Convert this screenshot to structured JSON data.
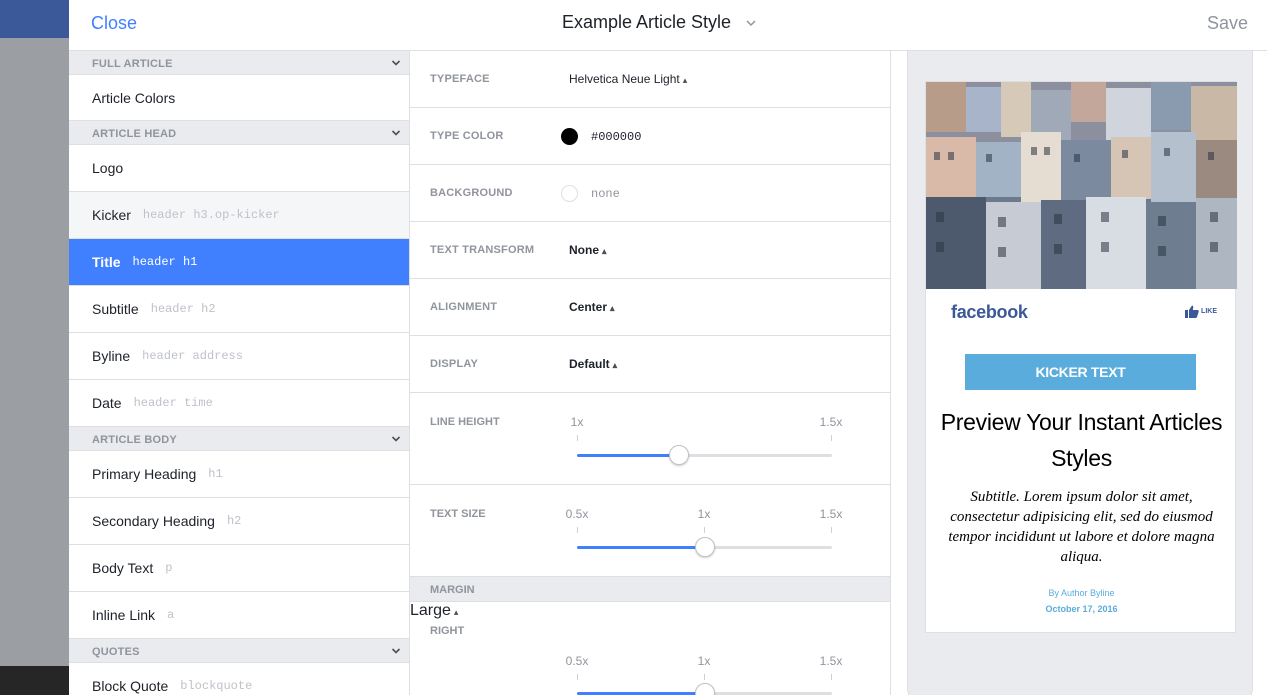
{
  "header": {
    "close_label": "Close",
    "title": "Example Article Style",
    "save_label": "Save"
  },
  "sidebar": {
    "sections": [
      {
        "label": "FULL ARTICLE",
        "items": [
          {
            "label": "Article Colors",
            "selector": ""
          }
        ]
      },
      {
        "label": "ARTICLE HEAD",
        "items": [
          {
            "label": "Logo",
            "selector": ""
          },
          {
            "label": "Kicker",
            "selector": "header h3.op-kicker"
          },
          {
            "label": "Title",
            "selector": "header h1"
          },
          {
            "label": "Subtitle",
            "selector": "header h2"
          },
          {
            "label": "Byline",
            "selector": "header address"
          },
          {
            "label": "Date",
            "selector": "header time"
          }
        ]
      },
      {
        "label": "ARTICLE BODY",
        "items": [
          {
            "label": "Primary Heading",
            "selector": "h1"
          },
          {
            "label": "Secondary Heading",
            "selector": "h2"
          },
          {
            "label": "Body Text",
            "selector": "p"
          },
          {
            "label": "Inline Link",
            "selector": "a"
          }
        ]
      },
      {
        "label": "QUOTES",
        "items": [
          {
            "label": "Block Quote",
            "selector": "blockquote"
          }
        ]
      }
    ],
    "active_item": "Title",
    "hover_item": "Kicker"
  },
  "settings": {
    "typeface": {
      "label": "TYPEFACE",
      "value": "Helvetica Neue Light"
    },
    "type_color": {
      "label": "TYPE COLOR",
      "value": "#000000",
      "swatch": "#000000"
    },
    "background": {
      "label": "BACKGROUND",
      "value": "none"
    },
    "text_transform": {
      "label": "TEXT TRANSFORM",
      "value": "None"
    },
    "alignment": {
      "label": "ALIGNMENT",
      "value": "Center"
    },
    "display": {
      "label": "DISPLAY",
      "value": "Default"
    },
    "line_height": {
      "label": "LINE HEIGHT",
      "min_label": "1x",
      "max_label": "1.5x",
      "level": 0.4
    },
    "text_size": {
      "label": "TEXT SIZE",
      "min_label": "0.5x",
      "mid_label": "1x",
      "max_label": "1.5x",
      "level": 0.5
    },
    "margin_header": "MARGIN",
    "margin_right": {
      "label": "RIGHT",
      "value": "Large",
      "min_label": "0.5x",
      "mid_label": "1x",
      "max_label": "1.5x",
      "level": 0.5
    }
  },
  "preview": {
    "brand": "facebook",
    "like_label": "LIKE",
    "kicker": "KICKER TEXT",
    "title": "Preview Your Instant Articles Styles",
    "subtitle": "Subtitle. Lorem ipsum dolor sit amet, consectetur adipisicing elit, sed do eiusmod tempor incididunt ut labore et dolore magna aliqua.",
    "byline": "By Author Byline",
    "date": "October 17, 2016"
  },
  "colors": {
    "accent": "#4080ff",
    "kicker_bg": "#59acdc",
    "facebook_blue": "#3b5998"
  },
  "icons": {
    "sort": "up-down-arrows-icon",
    "chevron": "chevron-down-icon",
    "like": "thumbs-up-icon"
  }
}
